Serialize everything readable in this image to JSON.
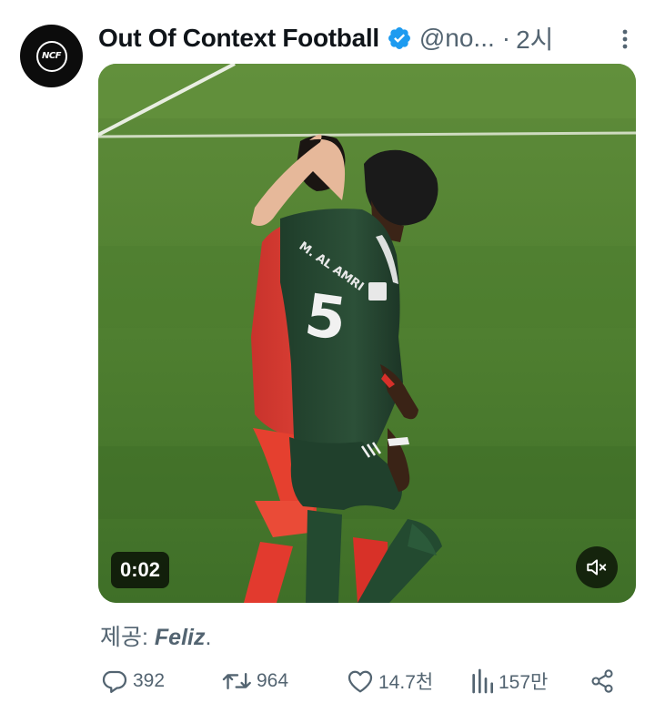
{
  "tweet": {
    "avatar_text": "NCF",
    "display_name": "Out Of Context Football",
    "handle": "@no...",
    "separator": "·",
    "time": "2시"
  },
  "media": {
    "duration": "0:02",
    "jersey_name": "M. AL AMRI",
    "jersey_number": "5"
  },
  "caption": {
    "prefix": "제공: ",
    "credit": "Feliz",
    "suffix": "."
  },
  "actions": {
    "replies": "392",
    "retweets": "964",
    "likes": "14.7천",
    "views": "157만"
  },
  "colors": {
    "text_primary": "#0f1419",
    "text_secondary": "#536471",
    "verified": "#1d9bf0",
    "pitch": "#4d7d2f"
  },
  "icons": {
    "verified": "verified-badge-icon",
    "more": "more-vertical-icon",
    "mute": "muted-speaker-icon",
    "reply": "reply-icon",
    "retweet": "retweet-icon",
    "like": "heart-icon",
    "views": "views-chart-icon",
    "share": "share-icon"
  }
}
